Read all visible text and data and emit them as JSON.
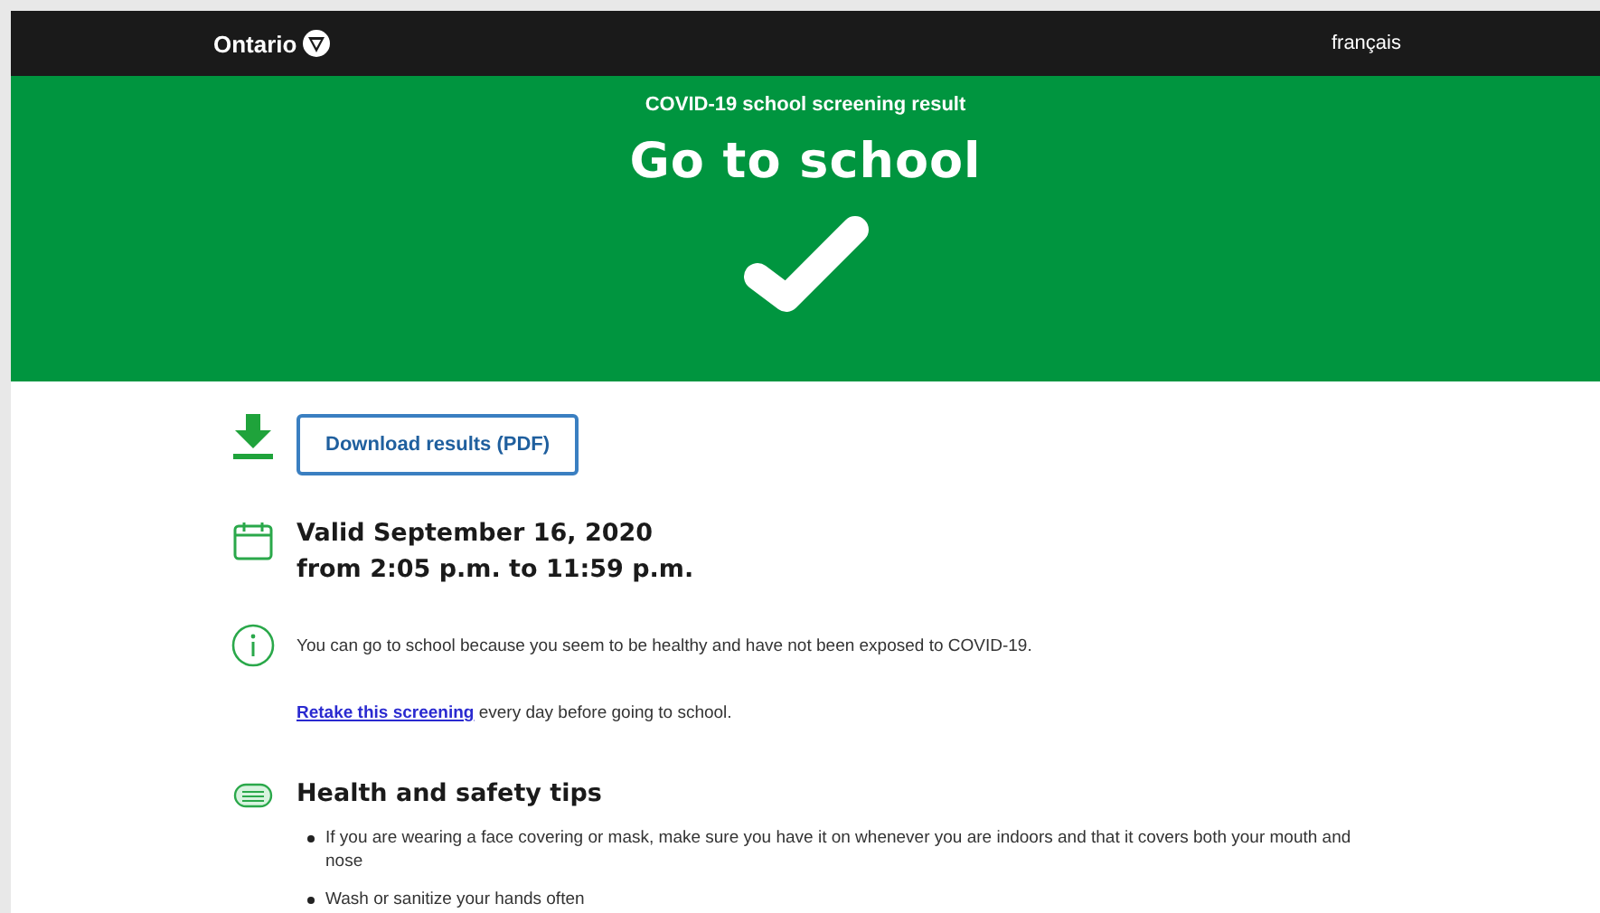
{
  "header": {
    "logo_text": "Ontario",
    "language_link": "français"
  },
  "banner": {
    "subtitle": "COVID-19 school screening result",
    "title": "Go to school"
  },
  "download_button": {
    "label": "Download results (PDF)"
  },
  "validity": {
    "date_line": "Valid September 16, 2020",
    "time_line": "from 2:05 p.m. to 11:59 p.m."
  },
  "info": {
    "text": "You can go to school because you seem to be healthy and have not been exposed to COVID-19."
  },
  "retake": {
    "link": "Retake this screening",
    "text": "every day before going to school."
  },
  "tips": {
    "heading": "Health and safety tips",
    "items": [
      "If you are wearing a face covering or mask, make sure you have it on whenever you are indoors and that it covers both your mouth and nose",
      "Wash or sanitize your hands often"
    ]
  }
}
